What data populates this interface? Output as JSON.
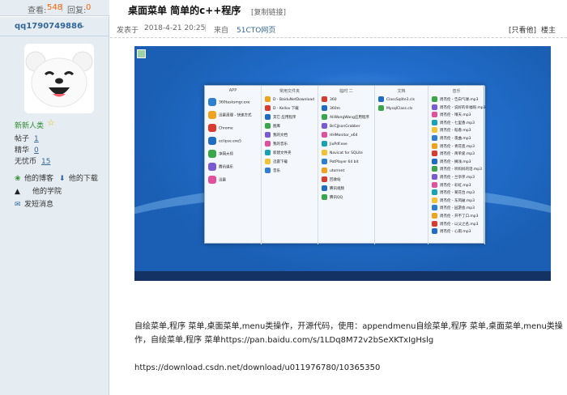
{
  "header": {
    "views_label": "查看:",
    "views_count": "548",
    "sep": "|",
    "replies_label": "回复:",
    "replies_count": "0",
    "post_title": "桌面菜单 简单的c++程序",
    "copy_link": "[复制链接]"
  },
  "author": {
    "username": "qq1790749886",
    "level": "新新人类",
    "stats": [
      {
        "label": "帖子",
        "value": "1"
      },
      {
        "label": "精华",
        "value": "0"
      },
      {
        "label": "无忧币",
        "value": "15"
      }
    ],
    "links": {
      "blog": "他的博客",
      "downloads": "他的下载",
      "academy": "他的学院",
      "message": "发短消息"
    }
  },
  "meta": {
    "posted_prefix": "发表于",
    "posted_time": "2018-4-21 20:25",
    "source_prefix": "来自",
    "source": "51CTO网页",
    "only_author": "[只看他]",
    "floor": "楼主"
  },
  "desktop": {
    "columns": [
      {
        "header": "APP",
        "items": [
          "360tasksmgr.exe",
          "迅雷清理 - 快速方式",
          "Chrome",
          "eclipse.exe5",
          "净网大师",
          "腾讯课乐",
          "迅雷"
        ]
      },
      {
        "header": "常用文件夹",
        "items": [
          "D - BaiduNetDownload",
          "D - Kellov 下载",
          "其它 应用程序",
          "图库",
          "我的文档",
          "我的音乐",
          "新建文件夹",
          "迅雷下载",
          "音乐"
        ]
      },
      {
        "header": "临时 二",
        "items": [
          "360",
          "360m",
          "AliWangWang应用程序",
          "BcCjJsonGrabber",
          "HHMonitor_x64",
          "JiuPdf.exe",
          "Navicat for SQLite",
          "PotPlayer 64 bit",
          "utorrent",
          "回收站",
          "腾讯视频",
          "腾讯QQ"
        ]
      },
      {
        "header": "文档",
        "items": [
          "ClassSqlite3.cls",
          "MysqlClass.cls"
        ]
      },
      {
        "header": "音乐",
        "items": [
          "周杰伦 - 告白气球.mp3",
          "周杰伦 - 说好的幸福呢.mp3",
          "周杰伦 - 晴天.mp3",
          "周杰伦 - 七里香.mp3",
          "周杰伦 - 稻香.mp3",
          "周杰伦 - 夜曲.mp3",
          "周杰伦 - 青花瓷.mp3",
          "周杰伦 - 简单爱.mp3",
          "周杰伦 - 搁浅.mp3",
          "周杰伦 - 听妈妈的话.mp3",
          "周杰伦 - 兰亭序.mp3",
          "周杰伦 - 彩虹.mp3",
          "周杰伦 - 菊花台.mp3",
          "周杰伦 - 东风破.mp3",
          "周杰伦 - 园游会.mp3",
          "周杰伦 - 开不了口.mp3",
          "周杰伦 - 以父之名.mp3",
          "周杰伦 - 心雨.mp3"
        ]
      }
    ]
  },
  "body": {
    "line1": "自绘菜单,程序 菜单,桌面菜单,menu类操作，开源代码，使用：appendmenu自绘菜单,程序 菜单,桌面菜单,menu类操",
    "line2": "作，自绘菜单,程序 菜单https://pan.baidu.com/s/1LDq8M72v2bSeXKTxIgHslg",
    "line3": "https://download.csdn.net/download/u011976780/10365350"
  },
  "colors": {
    "sidebar_bg": "#e5edf2",
    "link_blue": "#336699",
    "accent_orange": "#ff6600"
  }
}
